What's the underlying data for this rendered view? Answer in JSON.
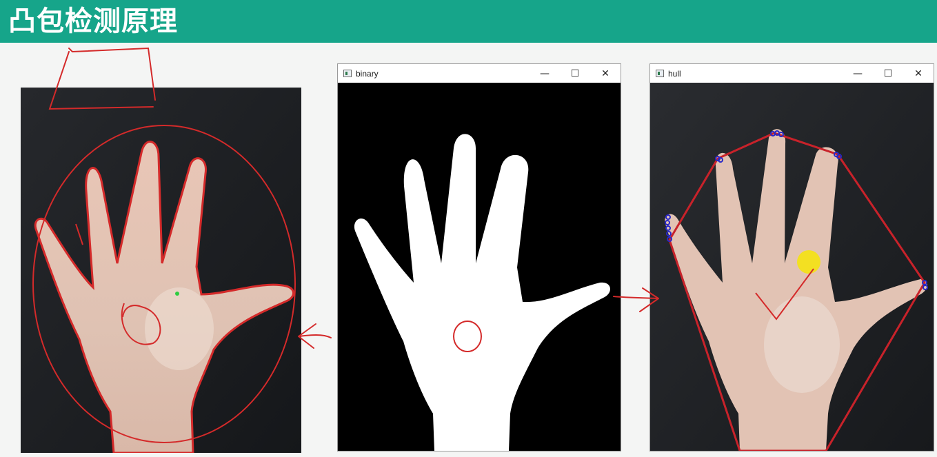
{
  "slide": {
    "title": "凸包检测原理",
    "accent_color": "#16a58a"
  },
  "windows": {
    "binary": {
      "title": "binary",
      "minimize": "—",
      "maximize": "☐",
      "close": "✕"
    },
    "hull": {
      "title": "hull",
      "minimize": "—",
      "maximize": "☐",
      "close": "✕"
    }
  },
  "annotations": {
    "ink_color": "#d42a2a",
    "hull_line_color": "#c8222a",
    "hull_point_color": "#2727c8",
    "highlight_color": "#f3e21a",
    "marker_dot_color": "#2ecc40"
  }
}
